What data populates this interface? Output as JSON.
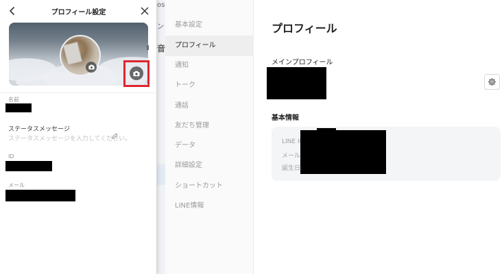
{
  "background_window": {
    "strip_fragments": [
      "os",
      "ン",
      "音"
    ],
    "nav_items": [
      {
        "label": "基本設定",
        "active": false
      },
      {
        "label": "プロフィール",
        "active": true
      },
      {
        "label": "通知",
        "active": false
      },
      {
        "label": "トーク",
        "active": false
      },
      {
        "label": "通話",
        "active": false
      },
      {
        "label": "友だち管理",
        "active": false
      },
      {
        "label": "データ",
        "active": false
      },
      {
        "label": "詳細設定",
        "active": false
      },
      {
        "label": "ショートカット",
        "active": false
      },
      {
        "label": "LINE情報",
        "active": false
      }
    ],
    "content": {
      "title": "プロフィール",
      "main_profile_label": "メインプロフィール",
      "basic_info_label": "基本情報",
      "info_rows": [
        "LINE ID",
        "メール",
        "誕生日"
      ],
      "settings_icon": "gear-icon"
    }
  },
  "panel": {
    "title": "プロフィール設定",
    "back_icon": "chevron-left-icon",
    "close_icon": "close-icon",
    "cover_camera_icon": "camera-icon",
    "avatar_camera_icon": "camera-icon",
    "highlight_color": "#e0242f",
    "fields": {
      "name_label": "名前",
      "status_label": "ステータスメッセージ",
      "status_placeholder": "ステータスメッセージを入力してください。",
      "status_edit_icon": "pencil-icon",
      "id_label": "ID",
      "email_label": "メール"
    }
  }
}
